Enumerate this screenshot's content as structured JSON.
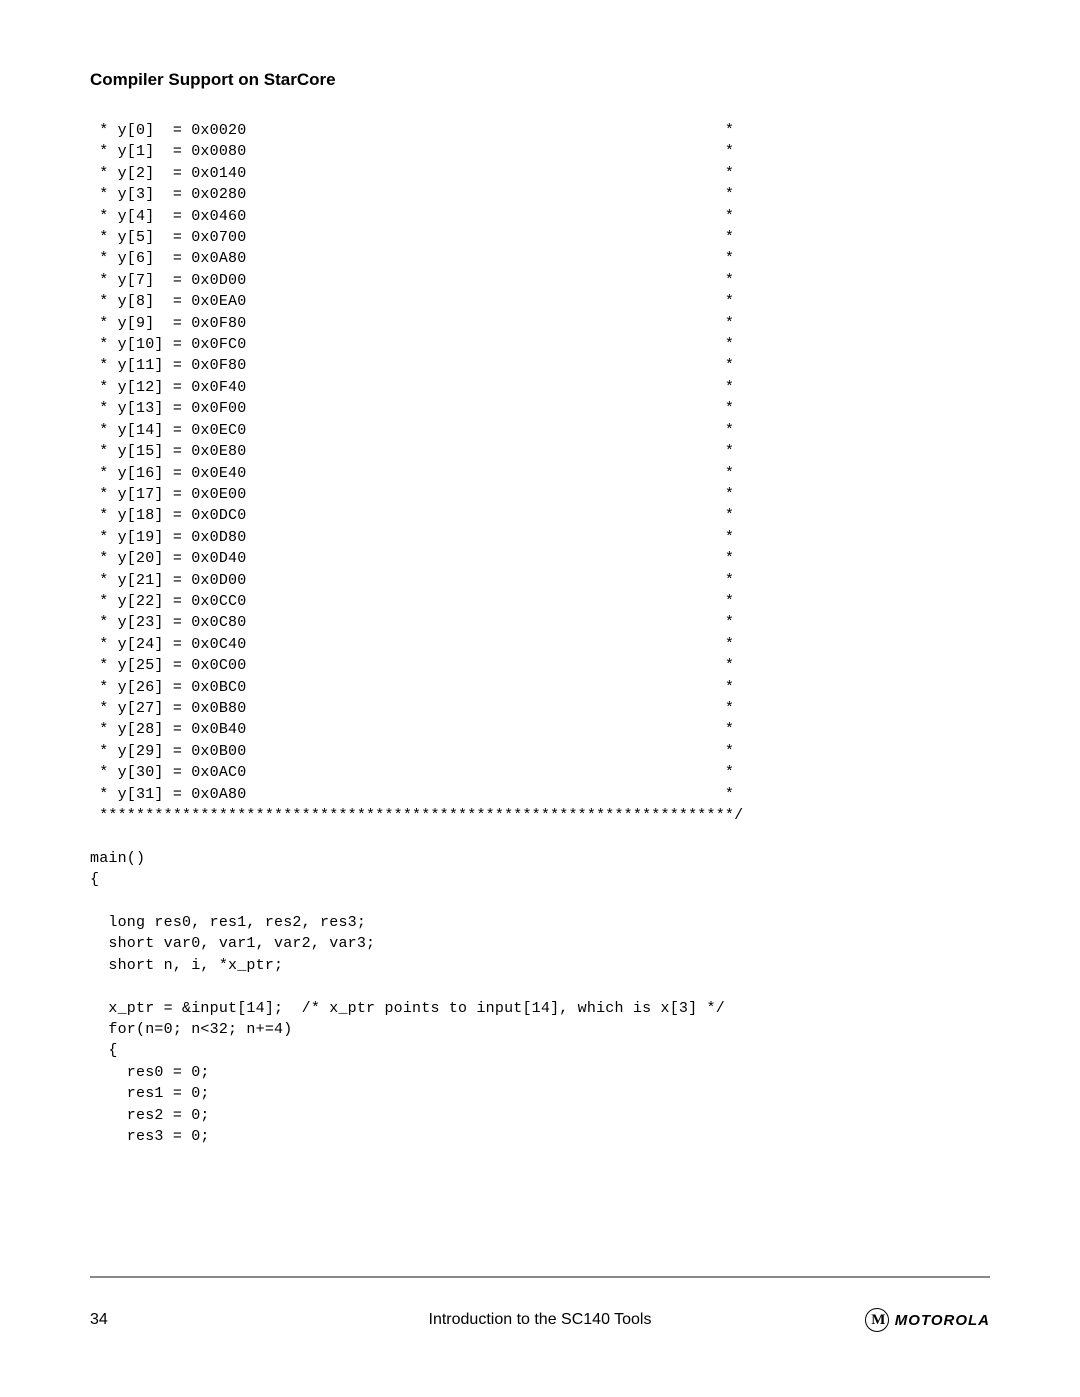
{
  "header": {
    "title": "Compiler Support on StarCore"
  },
  "code": {
    "lines": [
      " * y[0]  = 0x0020                                                    *",
      " * y[1]  = 0x0080                                                    *",
      " * y[2]  = 0x0140                                                    *",
      " * y[3]  = 0x0280                                                    *",
      " * y[4]  = 0x0460                                                    *",
      " * y[5]  = 0x0700                                                    *",
      " * y[6]  = 0x0A80                                                    *",
      " * y[7]  = 0x0D00                                                    *",
      " * y[8]  = 0x0EA0                                                    *",
      " * y[9]  = 0x0F80                                                    *",
      " * y[10] = 0x0FC0                                                    *",
      " * y[11] = 0x0F80                                                    *",
      " * y[12] = 0x0F40                                                    *",
      " * y[13] = 0x0F00                                                    *",
      " * y[14] = 0x0EC0                                                    *",
      " * y[15] = 0x0E80                                                    *",
      " * y[16] = 0x0E40                                                    *",
      " * y[17] = 0x0E00                                                    *",
      " * y[18] = 0x0DC0                                                    *",
      " * y[19] = 0x0D80                                                    *",
      " * y[20] = 0x0D40                                                    *",
      " * y[21] = 0x0D00                                                    *",
      " * y[22] = 0x0CC0                                                    *",
      " * y[23] = 0x0C80                                                    *",
      " * y[24] = 0x0C40                                                    *",
      " * y[25] = 0x0C00                                                    *",
      " * y[26] = 0x0BC0                                                    *",
      " * y[27] = 0x0B80                                                    *",
      " * y[28] = 0x0B40                                                    *",
      " * y[29] = 0x0B00                                                    *",
      " * y[30] = 0x0AC0                                                    *",
      " * y[31] = 0x0A80                                                    *",
      " *********************************************************************/",
      "",
      "main()",
      "{",
      "",
      "  long res0, res1, res2, res3;",
      "  short var0, var1, var2, var3;",
      "  short n, i, *x_ptr;",
      "",
      "  x_ptr = &input[14];  /* x_ptr points to input[14], which is x[3] */",
      "  for(n=0; n<32; n+=4)",
      "  {",
      "    res0 = 0;",
      "    res1 = 0;",
      "    res2 = 0;",
      "    res3 = 0;"
    ]
  },
  "footer": {
    "page_number": "34",
    "center_text": "Introduction to the SC140 Tools",
    "logo_text": "MOTOROLA"
  }
}
